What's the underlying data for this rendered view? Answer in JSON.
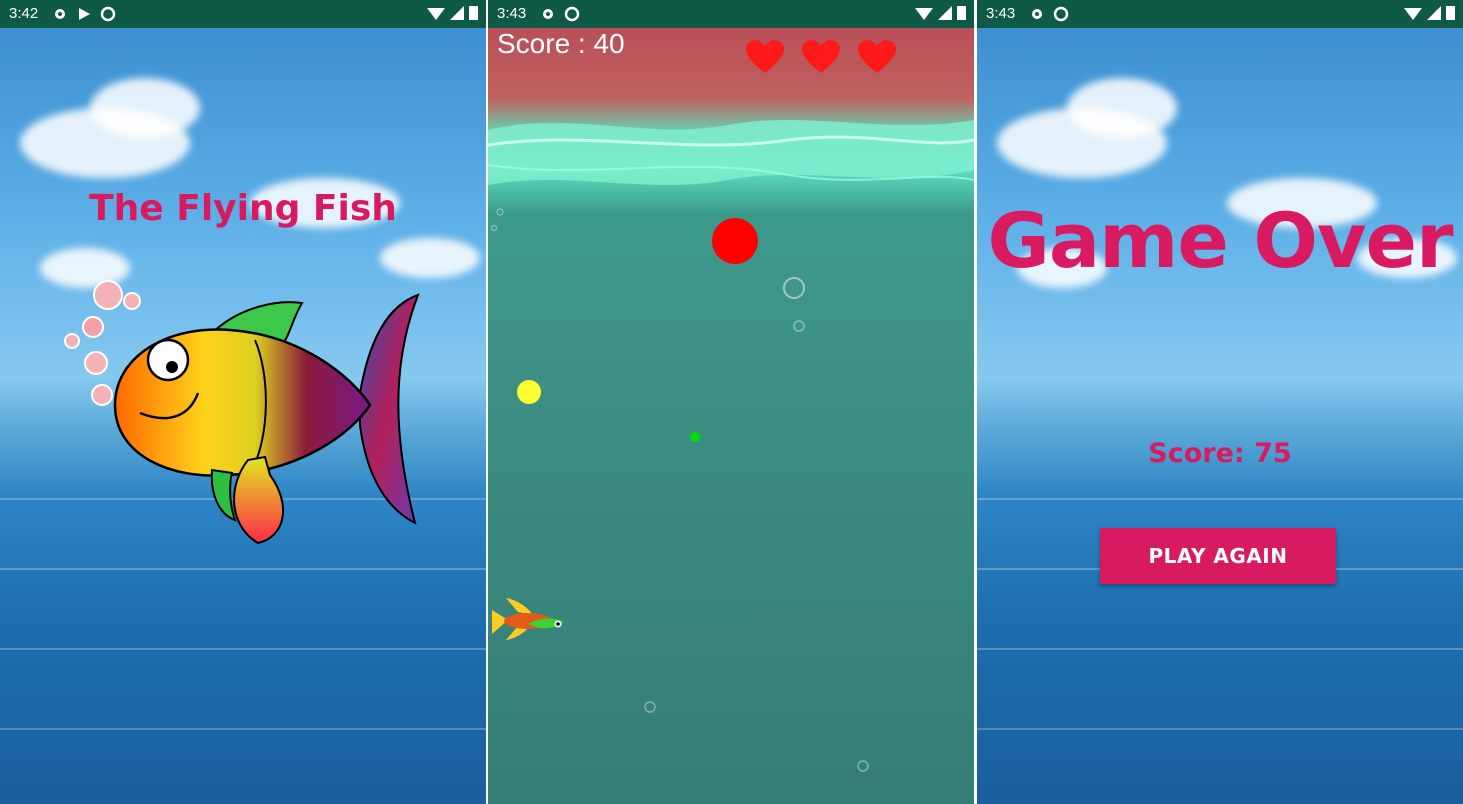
{
  "screens": {
    "splash": {
      "status_time": "3:42",
      "title": "The Flying Fish"
    },
    "gameplay": {
      "status_time": "3:43",
      "score_text": "Score : 40",
      "lives": 3,
      "items": [
        {
          "kind": "red-ball",
          "color": "#ff0000"
        },
        {
          "kind": "yellow-ball",
          "color": "#ffff33"
        },
        {
          "kind": "green-ball",
          "color": "#00e000"
        }
      ]
    },
    "game_over": {
      "status_time": "3:43",
      "title": "Game Over",
      "score_text": "Score: 75",
      "button_label": "PLAY AGAIN"
    }
  },
  "colors": {
    "accent": "#d81b60",
    "statusbar": "#0f5a47"
  }
}
